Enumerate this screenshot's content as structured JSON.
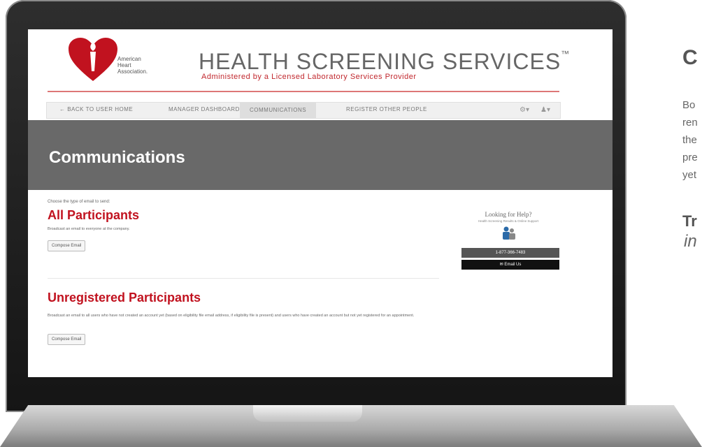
{
  "side": {
    "heading": "C",
    "body_lines": [
      "Bo",
      "ren",
      "the",
      "pre",
      "yet"
    ],
    "subheading": "Tr",
    "italic": "in"
  },
  "app": {
    "logo_lines": [
      "American",
      "Heart",
      "Association."
    ],
    "brand_title": "HEALTH SCREENING SERVICES",
    "brand_tm": "™",
    "brand_subtitle": "Administered by a Licensed Laboratory Services Provider"
  },
  "nav": {
    "items": [
      {
        "label": "← BACK TO USER HOME"
      },
      {
        "label": "MANAGER DASHBOARD"
      },
      {
        "label": "COMMUNICATIONS"
      },
      {
        "label": "REGISTER OTHER PEOPLE"
      }
    ],
    "settings_icon": "gear-icon",
    "user_icon": "user-icon",
    "settings_glyph": "⚙▾",
    "user_glyph": "♟▾"
  },
  "page": {
    "title": "Communications",
    "intro": "Choose the type of email to send:"
  },
  "sections": [
    {
      "title": "All Participants",
      "description": "Broadcast an email to everyone at the company.",
      "button": "Compose Email"
    },
    {
      "title": "Unregistered Participants",
      "description": "Broadcast an email to all users who have not created an account yet (based on eligibility file email address, if eligibility file is present) and users who have created an account but not yet registered for an appointment.",
      "button": "Compose Email"
    }
  ],
  "help": {
    "title": "Looking for Help?",
    "subtitle": "Health Screening Results & Online Support",
    "phone": "1-877-366-7483",
    "email": "✉ Email Us",
    "icon": "people-icon"
  },
  "colors": {
    "brand_red": "#c1121f",
    "band_gray": "#696969"
  }
}
